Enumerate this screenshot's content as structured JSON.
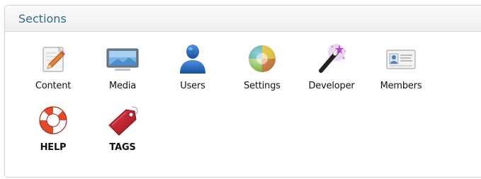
{
  "panel": {
    "title": "Sections"
  },
  "sections": {
    "content": {
      "label": "Content",
      "icon": "pencil-document-icon"
    },
    "media": {
      "label": "Media",
      "icon": "monitor-icon"
    },
    "users": {
      "label": "Users",
      "icon": "user-icon"
    },
    "settings": {
      "label": "Settings",
      "icon": "color-ball-icon"
    },
    "developer": {
      "label": "Developer",
      "icon": "magic-wand-icon"
    },
    "members": {
      "label": "Members",
      "icon": "id-card-icon"
    },
    "help": {
      "label": "HELP",
      "icon": "lifebuoy-icon"
    },
    "tags": {
      "label": "TAGS",
      "icon": "tag-icon"
    }
  },
  "colors": {
    "title": "#2d6d86",
    "user_blue": "#1f5fb3",
    "lifebuoy_red": "#e04a2b",
    "tag_red": "#c8202a"
  }
}
